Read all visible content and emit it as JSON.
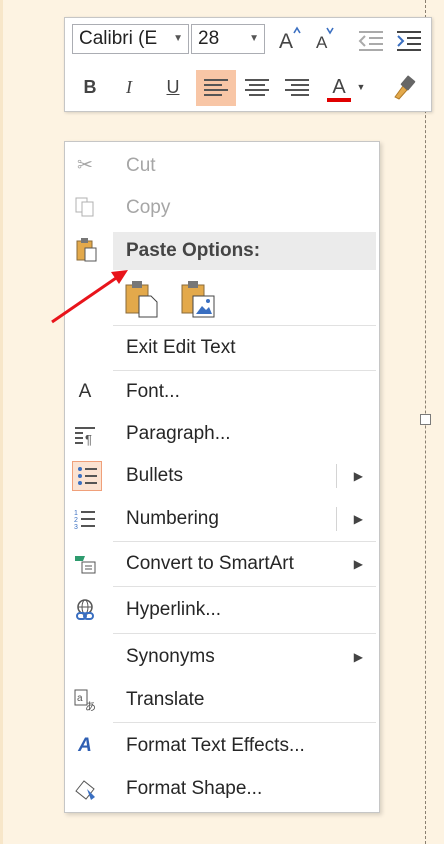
{
  "toolbar": {
    "font_name": "Calibri (E",
    "font_size": "28",
    "grow_font_icon": "grow-font-icon",
    "shrink_font_icon": "shrink-font-icon",
    "bold": "B",
    "italic": "I",
    "underline": "U",
    "font_color_letter": "A",
    "font_color": "#e00000",
    "active_highlight": "#f8c6a6"
  },
  "menu": {
    "items": [
      {
        "label": "Cut",
        "disabled": true,
        "icon": "scissors-icon"
      },
      {
        "label": "Copy",
        "disabled": true,
        "icon": "copy-icon"
      },
      {
        "label": "Paste Options:",
        "icon": "paste-icon"
      },
      {
        "label": "Exit Edit Text"
      },
      {
        "label": "Font...",
        "icon": "font-icon"
      },
      {
        "label": "Paragraph...",
        "icon": "paragraph-icon"
      },
      {
        "label": "Bullets",
        "icon": "bullets-icon",
        "submenu": true
      },
      {
        "label": "Numbering",
        "icon": "numbering-icon",
        "submenu": true
      },
      {
        "label": "Convert to SmartArt",
        "icon": "smartart-icon",
        "submenu": true
      },
      {
        "label": "Hyperlink...",
        "icon": "hyperlink-icon"
      },
      {
        "label": "Synonyms",
        "submenu": true
      },
      {
        "label": "Translate",
        "icon": "translate-icon"
      },
      {
        "label": "Format Text Effects...",
        "icon": "text-effects-icon"
      },
      {
        "label": "Format Shape...",
        "icon": "format-shape-icon"
      }
    ],
    "submenu_arrow": "▶",
    "annotation_color": "#e8141b"
  }
}
